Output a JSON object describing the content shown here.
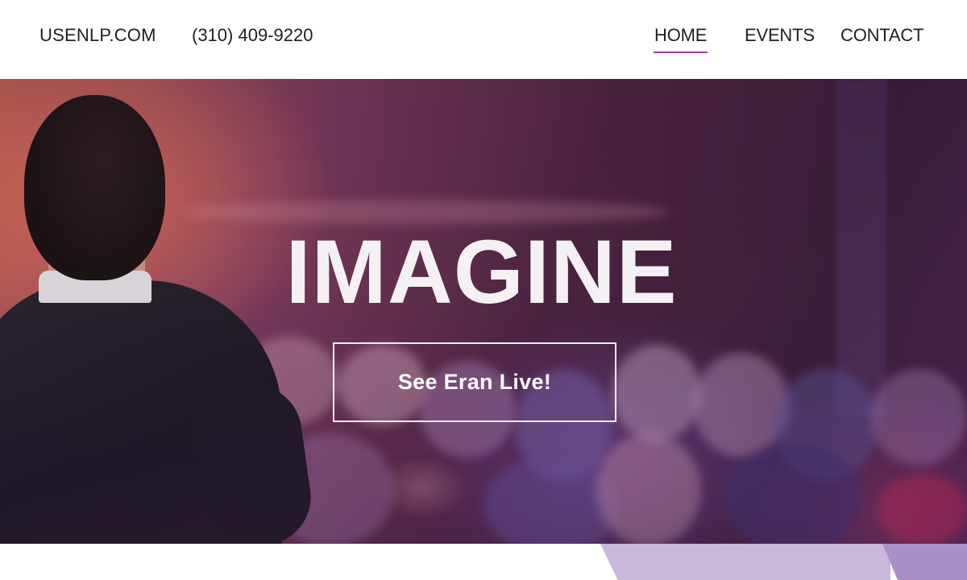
{
  "header": {
    "brand": "USENLP.COM",
    "phone": "(310) 409-9220",
    "nav": {
      "home": "HOME",
      "events": "EVENTS",
      "contact": "CONTACT"
    },
    "active_nav": "HOME",
    "accent_color": "#9a3fa3"
  },
  "hero": {
    "title": "IMAGINE",
    "cta_label": "See Eran Live!"
  },
  "colors": {
    "bottom_band_light": "#c8b8dc",
    "bottom_band_dark": "#a991c8"
  }
}
